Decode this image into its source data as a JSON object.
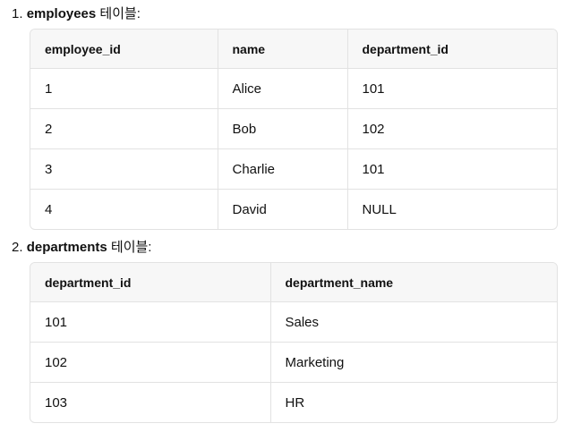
{
  "sections": [
    {
      "number": "1.",
      "table_name": "employees",
      "suffix": "테이블:",
      "columns": [
        "employee_id",
        "name",
        "department_id"
      ],
      "rows": [
        [
          "1",
          "Alice",
          "101"
        ],
        [
          "2",
          "Bob",
          "102"
        ],
        [
          "3",
          "Charlie",
          "101"
        ],
        [
          "4",
          "David",
          "NULL"
        ]
      ]
    },
    {
      "number": "2.",
      "table_name": "departments",
      "suffix": "테이블:",
      "columns": [
        "department_id",
        "department_name"
      ],
      "rows": [
        [
          "101",
          "Sales"
        ],
        [
          "102",
          "Marketing"
        ],
        [
          "103",
          "HR"
        ]
      ]
    }
  ]
}
